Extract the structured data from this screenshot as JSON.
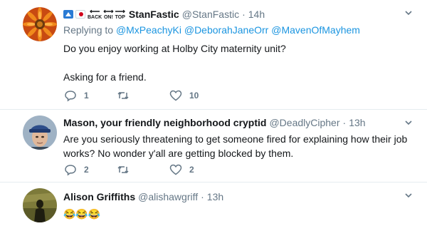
{
  "tweets": [
    {
      "name": "StanFastic",
      "handle": "@StanFastic",
      "time": "14h",
      "replying_prefix": "Replying to",
      "replying_to": [
        "@MxPeachyKi",
        "@DeborahJaneOrr",
        "@MavenOfMayhem"
      ],
      "text": "Do you enjoy working at Holby City maternity unit?\n\nAsking for a friend.",
      "name_emojis": {
        "back": "BACK",
        "on": "ON!",
        "top": "TOP"
      },
      "reply_count": "1",
      "retweet_count": "",
      "like_count": "10"
    },
    {
      "name": "Mason, your friendly neighborhood cryptid",
      "handle": "@DeadlyCipher",
      "time": "13h",
      "text": "Are you seriously threatening to get someone fired for explaining how their job works? No wonder y'all are getting blocked by them.",
      "reply_count": "2",
      "retweet_count": "",
      "like_count": "2"
    },
    {
      "name": "Alison Griffiths",
      "handle": "@alishawgriff",
      "time": "13h",
      "emoji_text": "😂😂😂"
    }
  ],
  "separator": "·",
  "colors": {
    "link": "#1b95e0",
    "muted": "#657786",
    "text": "#14171a",
    "divider": "#e6ecf0"
  },
  "icons": {
    "reply": "reply-icon",
    "retweet": "retweet-icon",
    "like": "heart-icon",
    "menu": "chevron-down-icon"
  }
}
